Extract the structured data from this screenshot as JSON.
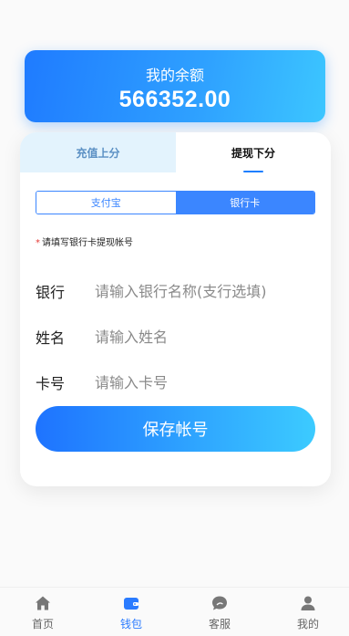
{
  "balance": {
    "label": "我的余额",
    "amount": "566352.00"
  },
  "tabs": {
    "recharge": "充值上分",
    "withdraw": "提现下分",
    "active": "withdraw"
  },
  "methods": {
    "alipay": "支付宝",
    "bank": "银行卡",
    "active": "bank"
  },
  "hint": {
    "star": "*",
    "text": "请填写银行卡提现帐号"
  },
  "form": {
    "bank": {
      "label": "银行",
      "placeholder": "请输入银行名称(支行选填)",
      "value": ""
    },
    "name": {
      "label": "姓名",
      "placeholder": "请输入姓名",
      "value": ""
    },
    "card": {
      "label": "卡号",
      "placeholder": "请输入卡号",
      "value": ""
    },
    "save_label": "保存帐号"
  },
  "nav": {
    "items": [
      {
        "label": "首页",
        "icon": "home-icon"
      },
      {
        "label": "钱包",
        "icon": "wallet-icon",
        "active": true
      },
      {
        "label": "客服",
        "icon": "chat-icon"
      },
      {
        "label": "我的",
        "icon": "user-icon"
      }
    ]
  },
  "colors": {
    "accent": "#3b86ff",
    "nav_active": "#2a7bff",
    "nav_inactive": "#777777",
    "hint_star": "#e53935"
  }
}
